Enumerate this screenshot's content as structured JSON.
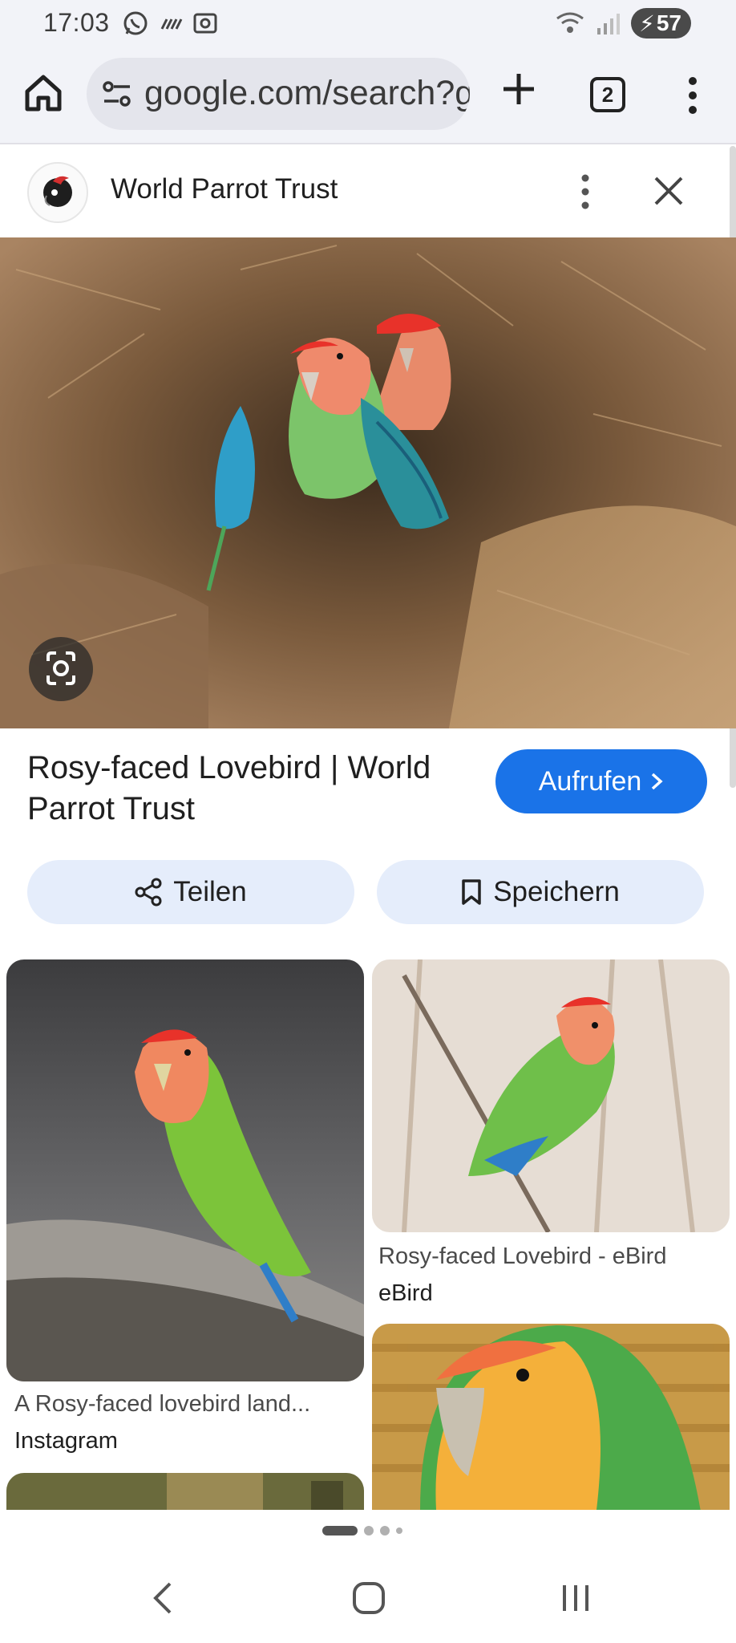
{
  "status_bar": {
    "time": "17:03",
    "battery": "57"
  },
  "browser": {
    "url": "google.com/search?g",
    "tab_count": "2"
  },
  "panel": {
    "site_name": "World Parrot Trust",
    "result_title": "Rosy-faced Lovebird | World Parrot Trust",
    "visit_label": "Aufrufen",
    "share_label": "Teilen",
    "save_label": "Speichern"
  },
  "grid": [
    {
      "caption": "A Rosy-faced lovebird land...",
      "source": "Instagram"
    },
    {
      "caption": "Rosy-faced Lovebird - eBird",
      "source": "eBird"
    }
  ],
  "colors": {
    "accent": "#1a73e8",
    "chip_bg": "#e5edfb",
    "toolbar_bg": "#f2f3f8"
  }
}
